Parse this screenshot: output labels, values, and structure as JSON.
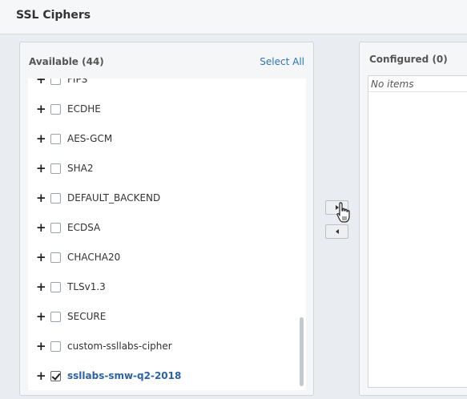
{
  "header": {
    "title": "SSL Ciphers"
  },
  "available": {
    "title": "Available (44)",
    "select_all": "Select All",
    "items": [
      {
        "label": "FIPS",
        "checked": false
      },
      {
        "label": "ECDHE",
        "checked": false
      },
      {
        "label": "AES-GCM",
        "checked": false
      },
      {
        "label": "SHA2",
        "checked": false
      },
      {
        "label": "DEFAULT_BACKEND",
        "checked": false
      },
      {
        "label": "ECDSA",
        "checked": false
      },
      {
        "label": "CHACHA20",
        "checked": false
      },
      {
        "label": "TLSv1.3",
        "checked": false
      },
      {
        "label": "SECURE",
        "checked": false
      },
      {
        "label": "custom-ssllabs-cipher",
        "checked": false
      },
      {
        "label": "ssllabs-smw-q2-2018",
        "checked": true
      }
    ],
    "expand_glyph": "+"
  },
  "configured": {
    "title": "Configured (0)",
    "empty_text": "No items"
  },
  "icons": {
    "add": "caret-right-icon",
    "remove": "caret-left-icon",
    "cursor": "hand-pointer-icon"
  },
  "colors": {
    "link": "#2e74b5",
    "selected_text": "#2b62a6",
    "background": "#e9edf1"
  }
}
